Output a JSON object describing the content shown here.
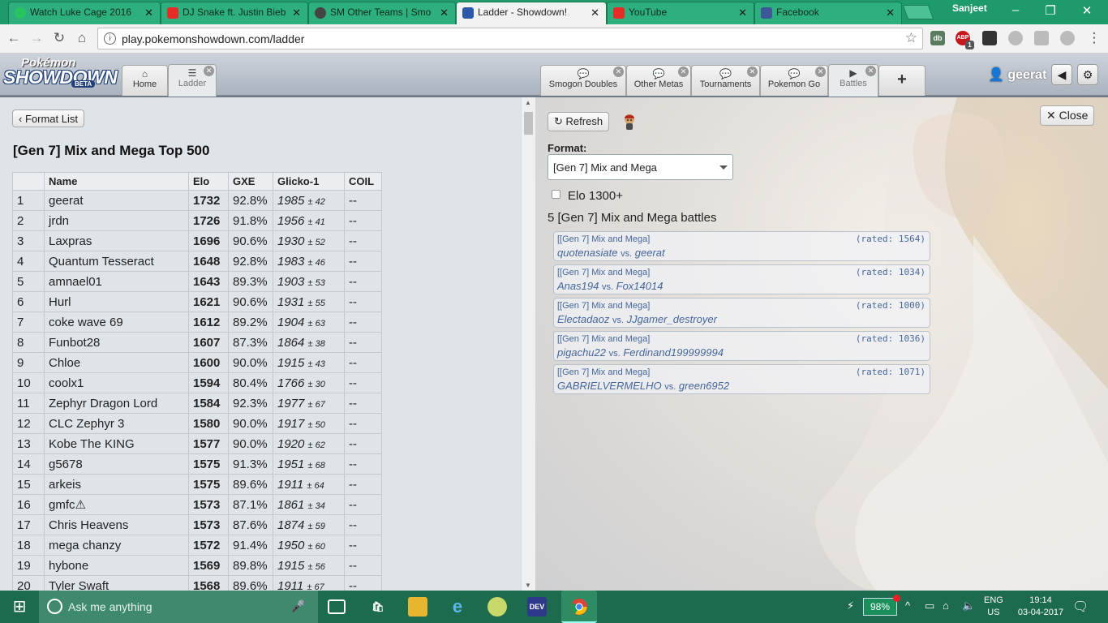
{
  "browser": {
    "tabs": [
      {
        "title": "Watch Luke Cage 2016",
        "favicon": "play-icon",
        "color": "#27c462"
      },
      {
        "title": "DJ Snake ft. Justin Bieb",
        "favicon": "youtube-icon",
        "color": "#e52d27"
      },
      {
        "title": "SM Other Teams | Smo",
        "favicon": "smogon-icon",
        "color": "#444444"
      },
      {
        "title": "Ladder - Showdown!",
        "favicon": "showdown-icon",
        "color": "#2a5aa8"
      },
      {
        "title": "YouTube",
        "favicon": "youtube-icon",
        "color": "#e52d27"
      },
      {
        "title": "Facebook",
        "favicon": "facebook-icon",
        "color": "#3b5998"
      }
    ],
    "profile_name": "Sanjeet",
    "url": "play.pokemonshowdown.com/ladder",
    "ext_abp_badge": "ABP",
    "ext_abp_count": "1",
    "ext_db": "db"
  },
  "header": {
    "logo_top": "Pokémon",
    "logo_main": "SHOWDOWN",
    "logo_beta": "BETA",
    "left_tabs": [
      {
        "label": "Home",
        "icon": "home-icon"
      },
      {
        "label": "Ladder",
        "icon": "list-icon"
      }
    ],
    "right_tabs": [
      {
        "label": "Smogon Doubles",
        "icon": "chat-icon"
      },
      {
        "label": "Other Metas",
        "icon": "chat-icon"
      },
      {
        "label": "Tournaments",
        "icon": "chat-icon"
      },
      {
        "label": "Pokemon Go",
        "icon": "chat-icon"
      },
      {
        "label": "Battles",
        "icon": "battles-icon"
      }
    ],
    "add_tab": "+",
    "username": "geerat"
  },
  "ladder": {
    "back_button": "Format List",
    "title": "[Gen 7] Mix and Mega Top 500",
    "columns": [
      "",
      "Name",
      "Elo",
      "GXE",
      "Glicko-1",
      "COIL"
    ],
    "rows": [
      {
        "rank": "1",
        "name": "geerat",
        "elo": "1732",
        "gxe": "92.8%",
        "glicko": "1985",
        "dev": "± 42",
        "coil": "--"
      },
      {
        "rank": "2",
        "name": "jrdn",
        "elo": "1726",
        "gxe": "91.8%",
        "glicko": "1956",
        "dev": "± 41",
        "coil": "--"
      },
      {
        "rank": "3",
        "name": "Laxpras",
        "elo": "1696",
        "gxe": "90.6%",
        "glicko": "1930",
        "dev": "± 52",
        "coil": "--"
      },
      {
        "rank": "4",
        "name": "Quantum Tesseract",
        "elo": "1648",
        "gxe": "92.8%",
        "glicko": "1983",
        "dev": "± 46",
        "coil": "--"
      },
      {
        "rank": "5",
        "name": "amnael01",
        "elo": "1643",
        "gxe": "89.3%",
        "glicko": "1903",
        "dev": "± 53",
        "coil": "--"
      },
      {
        "rank": "6",
        "name": "Hurl",
        "elo": "1621",
        "gxe": "90.6%",
        "glicko": "1931",
        "dev": "± 55",
        "coil": "--"
      },
      {
        "rank": "7",
        "name": "coke wave 69",
        "elo": "1612",
        "gxe": "89.2%",
        "glicko": "1904",
        "dev": "± 63",
        "coil": "--"
      },
      {
        "rank": "8",
        "name": "Funbot28",
        "elo": "1607",
        "gxe": "87.3%",
        "glicko": "1864",
        "dev": "± 38",
        "coil": "--"
      },
      {
        "rank": "9",
        "name": "Chloe",
        "elo": "1600",
        "gxe": "90.0%",
        "glicko": "1915",
        "dev": "± 43",
        "coil": "--"
      },
      {
        "rank": "10",
        "name": "coolx1",
        "elo": "1594",
        "gxe": "80.4%",
        "glicko": "1766",
        "dev": "± 30",
        "coil": "--"
      },
      {
        "rank": "11",
        "name": "Zephyr Dragon Lord",
        "elo": "1584",
        "gxe": "92.3%",
        "glicko": "1977",
        "dev": "± 67",
        "coil": "--"
      },
      {
        "rank": "12",
        "name": "CLC Zephyr 3",
        "elo": "1580",
        "gxe": "90.0%",
        "glicko": "1917",
        "dev": "± 50",
        "coil": "--"
      },
      {
        "rank": "13",
        "name": "Kobe The KING",
        "elo": "1577",
        "gxe": "90.0%",
        "glicko": "1920",
        "dev": "± 62",
        "coil": "--"
      },
      {
        "rank": "14",
        "name": "g5678",
        "elo": "1575",
        "gxe": "91.3%",
        "glicko": "1951",
        "dev": "± 68",
        "coil": "--"
      },
      {
        "rank": "15",
        "name": "arkeis",
        "elo": "1575",
        "gxe": "89.6%",
        "glicko": "1911",
        "dev": "± 64",
        "coil": "--"
      },
      {
        "rank": "16",
        "name": "gmfc⚠",
        "elo": "1573",
        "gxe": "87.1%",
        "glicko": "1861",
        "dev": "± 34",
        "coil": "--"
      },
      {
        "rank": "17",
        "name": "Chris Heavens",
        "elo": "1573",
        "gxe": "87.6%",
        "glicko": "1874",
        "dev": "± 59",
        "coil": "--"
      },
      {
        "rank": "18",
        "name": "mega chanzy",
        "elo": "1572",
        "gxe": "91.4%",
        "glicko": "1950",
        "dev": "± 60",
        "coil": "--"
      },
      {
        "rank": "19",
        "name": "hybone",
        "elo": "1569",
        "gxe": "89.8%",
        "glicko": "1915",
        "dev": "± 56",
        "coil": "--"
      },
      {
        "rank": "20",
        "name": "Tyler Swaft",
        "elo": "1568",
        "gxe": "89.6%",
        "glicko": "1911",
        "dev": "± 67",
        "coil": "--"
      }
    ]
  },
  "battles": {
    "refresh_button": "Refresh",
    "close_button": "Close",
    "format_label": "Format:",
    "format_selected": "[Gen 7] Mix and Mega",
    "elo_filter": "Elo 1300+",
    "elo_filter_checked": false,
    "count_text": "5 [Gen 7] Mix and Mega battles",
    "list": [
      {
        "format": "[[Gen 7] Mix and Mega]",
        "rated": "(rated: 1564)",
        "p1": "quotenasiate",
        "vs": "vs.",
        "p2": "geerat"
      },
      {
        "format": "[[Gen 7] Mix and Mega]",
        "rated": "(rated: 1034)",
        "p1": "Anas194",
        "vs": "vs.",
        "p2": "Fox14014"
      },
      {
        "format": "[[Gen 7] Mix and Mega]",
        "rated": "(rated: 1000)",
        "p1": "Electadaoz",
        "vs": "vs.",
        "p2": "JJgamer_destroyer"
      },
      {
        "format": "[[Gen 7] Mix and Mega]",
        "rated": "(rated: 1036)",
        "p1": "pigachu22",
        "vs": "vs.",
        "p2": "Ferdinand199999994"
      },
      {
        "format": "[[Gen 7] Mix and Mega]",
        "rated": "(rated: 1071)",
        "p1": "GABRIELVERMELHO",
        "vs": "vs.",
        "p2": "green6952"
      }
    ]
  },
  "taskbar": {
    "search_placeholder": "Ask me anything",
    "battery": "98%",
    "lang_top": "ENG",
    "lang_bottom": "US",
    "time": "19:14",
    "date": "03-04-2017",
    "apps": [
      {
        "name": "task-view-icon",
        "color": "#1c6b4d"
      },
      {
        "name": "store-icon",
        "color": "#1c6b4d"
      },
      {
        "name": "file-explorer-icon",
        "color": "#e8b530"
      },
      {
        "name": "edge-icon",
        "color": "#1c6b4d"
      },
      {
        "name": "game-icon",
        "color": "#c9d86a"
      },
      {
        "name": "dev-icon",
        "color": "#2d3a8a"
      },
      {
        "name": "chrome-icon",
        "color": "#2e8b63"
      }
    ]
  }
}
